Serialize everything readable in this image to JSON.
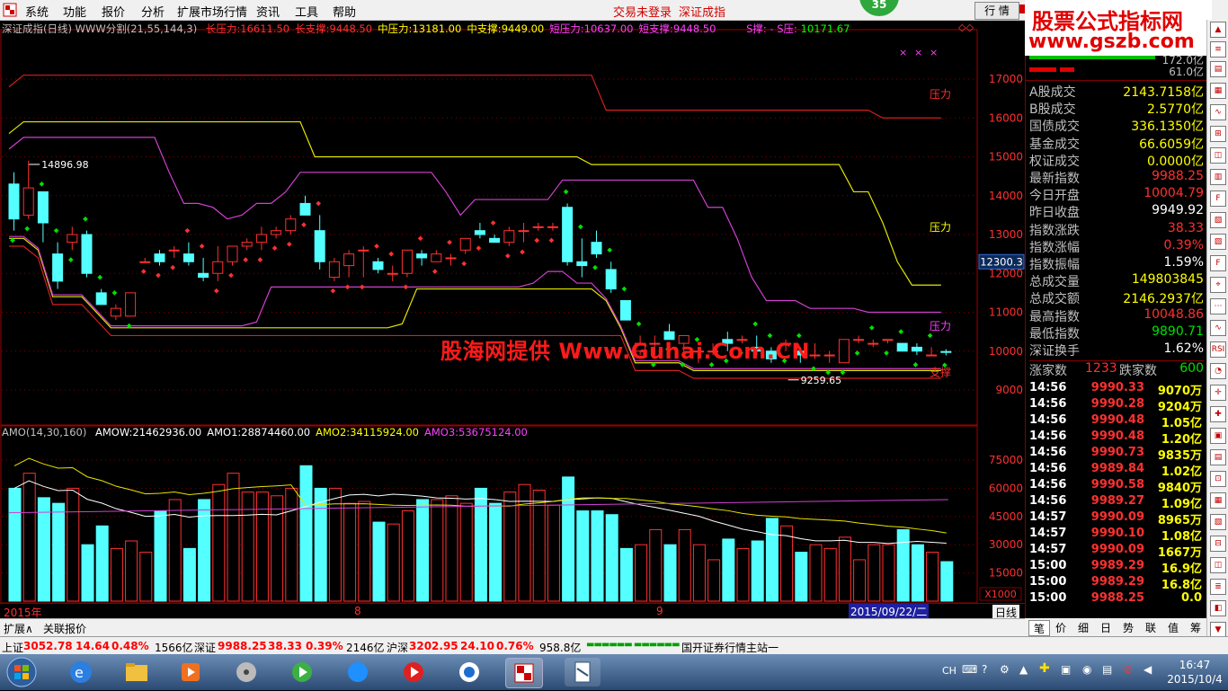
{
  "menu": {
    "items": [
      "系统",
      "功能",
      "报价",
      "分析",
      "扩展市场行情",
      "资讯",
      "工具",
      "帮助"
    ],
    "trade_status": "交易未登录",
    "index_name": "深证成指",
    "badge": "35",
    "quote_button": "行 情"
  },
  "brand": {
    "line1": "股票公式指标网",
    "line2": "www.gszb.com"
  },
  "indicator_header": {
    "name": "深证成指(日线) WWW分割(21,55,144,3)",
    "items": [
      {
        "label": "长压力:",
        "value": "16611.50",
        "color": "#ff3030"
      },
      {
        "label": "长支撑:",
        "value": "9448.50",
        "color": "#ff3030"
      },
      {
        "label": "中压力:",
        "value": "13181.00",
        "color": "#ffff00"
      },
      {
        "label": "中支撑:",
        "value": "9449.00",
        "color": "#ffff00"
      },
      {
        "label": "短压力:",
        "value": "10637.00",
        "color": "#ff40ff"
      },
      {
        "label": "短支撑:",
        "value": "9448.50",
        "color": "#ff40ff"
      }
    ],
    "s_label": "S撑: - S压:",
    "s_value": "10171.67"
  },
  "amo_header": {
    "name": "AMO(14,30,160)",
    "items": [
      {
        "label": "AMOW:",
        "value": "21462936.00",
        "color": "#ffffff"
      },
      {
        "label": "AMO1:",
        "value": "28874460.00",
        "color": "#ffffff"
      },
      {
        "label": "AMO2:",
        "value": "34115924.00",
        "color": "#ffff00"
      },
      {
        "label": "AMO3:",
        "value": "53675124.00",
        "color": "#ff40ff"
      }
    ]
  },
  "price_axis": [
    "17000",
    "16000",
    "15000",
    "14000",
    "13000",
    "12000",
    "11000",
    "10000",
    "9000"
  ],
  "price_current": "12300.3",
  "volume_axis": [
    "75000",
    "60000",
    "45000",
    "30000",
    "15000"
  ],
  "volume_unit": "X1000",
  "chart_labels": {
    "high": "14896.98",
    "low": "9259.65",
    "pressure": "压力",
    "support": "支撑"
  },
  "watermark": "股海网提供 Www.Guhai.Com.CN",
  "date_axis": {
    "year": "2015年",
    "m8": "8",
    "m9": "9",
    "cursor_date": "2015/09/22/二",
    "period": "日线"
  },
  "subtabs": [
    "扩展∧",
    "关联报价"
  ],
  "right_panel": {
    "top_values": [
      "172.0亿",
      "61.0亿"
    ],
    "stats": [
      {
        "label": "A股成交",
        "value": "2143.7158亿",
        "color": "#ffff00"
      },
      {
        "label": "B股成交",
        "value": "2.5770亿",
        "color": "#ffff00"
      },
      {
        "label": "国债成交",
        "value": "336.1350亿",
        "color": "#ffff00"
      },
      {
        "label": "基金成交",
        "value": "66.6059亿",
        "color": "#ffff00"
      },
      {
        "label": "权证成交",
        "value": "0.0000亿",
        "color": "#ffff00"
      },
      {
        "label": "最新指数",
        "value": "9988.25",
        "color": "#ff3030"
      },
      {
        "label": "今日开盘",
        "value": "10004.79",
        "color": "#ff3030"
      },
      {
        "label": "昨日收盘",
        "value": "9949.92",
        "color": "#ffffff"
      },
      {
        "label": "指数涨跌",
        "value": "38.33",
        "color": "#ff3030"
      },
      {
        "label": "指数涨幅",
        "value": "0.39%",
        "color": "#ff3030"
      },
      {
        "label": "指数振幅",
        "value": "1.59%",
        "color": "#ffffff"
      },
      {
        "label": "总成交量",
        "value": "149803845",
        "color": "#ffff00"
      },
      {
        "label": "总成交额",
        "value": "2146.2937亿",
        "color": "#ffff00"
      },
      {
        "label": "最高指数",
        "value": "10048.86",
        "color": "#ff3030"
      },
      {
        "label": "最低指数",
        "value": "9890.71",
        "color": "#00e000"
      },
      {
        "label": "深证换手",
        "value": "1.62%",
        "color": "#ffffff"
      }
    ],
    "breadth": {
      "up_label": "涨家数",
      "up_value": "1233",
      "down_label": "跌家数",
      "down_value": "600"
    },
    "ticks": [
      {
        "time": "14:56",
        "price": "9990.33",
        "vol": "9070万"
      },
      {
        "time": "14:56",
        "price": "9990.28",
        "vol": "9204万"
      },
      {
        "time": "14:56",
        "price": "9990.48",
        "vol": "1.05亿"
      },
      {
        "time": "14:56",
        "price": "9990.48",
        "vol": "1.20亿"
      },
      {
        "time": "14:56",
        "price": "9990.73",
        "vol": "9835万"
      },
      {
        "time": "14:56",
        "price": "9989.84",
        "vol": "1.02亿"
      },
      {
        "time": "14:56",
        "price": "9990.58",
        "vol": "9840万"
      },
      {
        "time": "14:56",
        "price": "9989.27",
        "vol": "1.09亿"
      },
      {
        "time": "14:57",
        "price": "9990.09",
        "vol": "8965万"
      },
      {
        "time": "14:57",
        "price": "9990.10",
        "vol": "1.08亿"
      },
      {
        "time": "14:57",
        "price": "9990.09",
        "vol": "1667万"
      },
      {
        "time": "15:00",
        "price": "9989.29",
        "vol": "16.9亿"
      },
      {
        "time": "15:00",
        "price": "9989.29",
        "vol": "16.8亿"
      },
      {
        "time": "15:00",
        "price": "9988.25",
        "vol": "0.0"
      }
    ],
    "tabs": [
      "笔",
      "价",
      "细",
      "日",
      "势",
      "联",
      "值",
      "筹"
    ]
  },
  "statusbar": {
    "sh_label": "上证",
    "sh_value": "3052.78",
    "sh_chg": "14.64",
    "sh_pct": "0.48%",
    "sh_amt": "1566亿",
    "sz_label": "深证",
    "sz_value": "9988.25",
    "sz_chg": "38.33",
    "sz_pct": "0.39%",
    "sz_amt": "2146亿",
    "hs_label": "沪深",
    "hs_value": "3202.95",
    "hs_chg": "24.10",
    "hs_pct": "0.76%",
    "hs_amt": "958.8亿",
    "broker": "国开证券行情主站一"
  },
  "clock": {
    "time": "16:47",
    "date": "2015/10/4"
  },
  "tray": {
    "lang": "CH"
  },
  "chart_data": {
    "type": "candlestick",
    "candles": [
      [
        14300,
        14600,
        13100,
        13400
      ],
      [
        13500,
        14900,
        13400,
        14200
      ],
      [
        14100,
        14000,
        12800,
        13300
      ],
      [
        12500,
        12800,
        11600,
        11800
      ],
      [
        12800,
        13200,
        12600,
        13000
      ],
      [
        13000,
        13100,
        11900,
        12000
      ],
      [
        11500,
        11600,
        11200,
        11200
      ],
      [
        10900,
        11200,
        10800,
        11100
      ],
      [
        10900,
        11500,
        10900,
        11500
      ],
      [
        12300,
        12400,
        12300,
        12300
      ],
      [
        12500,
        12600,
        12200,
        12300
      ],
      [
        12600,
        12700,
        12400,
        12600
      ],
      [
        12500,
        12800,
        12200,
        12300
      ],
      [
        12000,
        12400,
        11800,
        11900
      ],
      [
        12000,
        12700,
        11800,
        12300
      ],
      [
        12300,
        12700,
        12200,
        12700
      ],
      [
        12700,
        12900,
        12600,
        12800
      ],
      [
        12800,
        13200,
        12600,
        13000
      ],
      [
        13000,
        13200,
        12900,
        13100
      ],
      [
        13100,
        13500,
        13000,
        13400
      ],
      [
        13800,
        14000,
        13500,
        13500
      ],
      [
        13100,
        13500,
        12100,
        12300
      ],
      [
        11900,
        12400,
        11800,
        12300
      ],
      [
        12200,
        12600,
        11900,
        12500
      ],
      [
        12600,
        12700,
        11900,
        12600
      ],
      [
        12300,
        12400,
        12000,
        12100
      ],
      [
        12000,
        12200,
        11800,
        12000
      ],
      [
        12000,
        12600,
        11900,
        12600
      ],
      [
        12500,
        12600,
        12200,
        12400
      ],
      [
        12300,
        12600,
        12300,
        12500
      ],
      [
        12400,
        12500,
        12200,
        12400
      ],
      [
        12600,
        12900,
        12500,
        12900
      ],
      [
        13100,
        13300,
        12900,
        13000
      ],
      [
        12900,
        13000,
        12800,
        12800
      ],
      [
        12800,
        13200,
        12700,
        13100
      ],
      [
        13100,
        13300,
        12800,
        13100
      ],
      [
        13200,
        13300,
        13100,
        13200
      ],
      [
        13200,
        13300,
        13100,
        13200
      ],
      [
        13700,
        13800,
        12200,
        12300
      ],
      [
        12300,
        12900,
        11900,
        12200
      ],
      [
        12800,
        13100,
        12400,
        12500
      ],
      [
        12100,
        12300,
        11500,
        11600
      ],
      [
        11300,
        11300,
        10800,
        10800
      ],
      [
        10000,
        10400,
        9900,
        10200
      ],
      [
        10200,
        10400,
        9900,
        10200
      ],
      [
        10500,
        10700,
        10300,
        10300
      ],
      [
        10200,
        10400,
        9900,
        10400
      ],
      [
        10000,
        10000,
        9700,
        10000
      ],
      [
        10000,
        10200,
        9900,
        10000
      ],
      [
        10300,
        10500,
        10000,
        10200
      ],
      [
        10300,
        10400,
        10200,
        10300
      ],
      [
        10100,
        10400,
        9900,
        10000
      ],
      [
        10000,
        10100,
        9700,
        9800
      ],
      [
        10200,
        10300,
        10000,
        10200
      ],
      [
        10000,
        10100,
        9700,
        9900
      ],
      [
        9900,
        10200,
        9800,
        9900
      ],
      [
        9900,
        10000,
        9700,
        9900
      ],
      [
        9700,
        10300,
        9700,
        10300
      ],
      [
        10300,
        10400,
        10200,
        10300
      ],
      [
        10200,
        10300,
        10100,
        10200
      ],
      [
        10300,
        10300,
        10200,
        10300
      ],
      [
        10200,
        10200,
        10000,
        10000
      ],
      [
        10100,
        10200,
        9900,
        10000
      ],
      [
        9900,
        10100,
        9900,
        9900
      ],
      [
        9990,
        10049,
        9890,
        9988
      ]
    ],
    "volume": [
      60,
      68,
      55,
      52,
      60,
      30,
      40,
      28,
      32,
      26,
      48,
      54,
      28,
      54,
      62,
      68,
      58,
      58,
      56,
      60,
      72,
      60,
      60,
      52,
      53,
      42,
      41,
      48,
      54,
      54,
      56,
      52,
      60,
      52,
      58,
      62,
      59,
      51,
      66,
      48,
      48,
      46,
      28,
      30,
      38,
      30,
      38,
      30,
      22,
      33,
      28,
      32,
      44,
      40,
      26,
      30,
      28,
      34,
      22,
      30,
      30,
      38,
      30,
      26,
      21
    ],
    "volume_unit": "X1000"
  }
}
